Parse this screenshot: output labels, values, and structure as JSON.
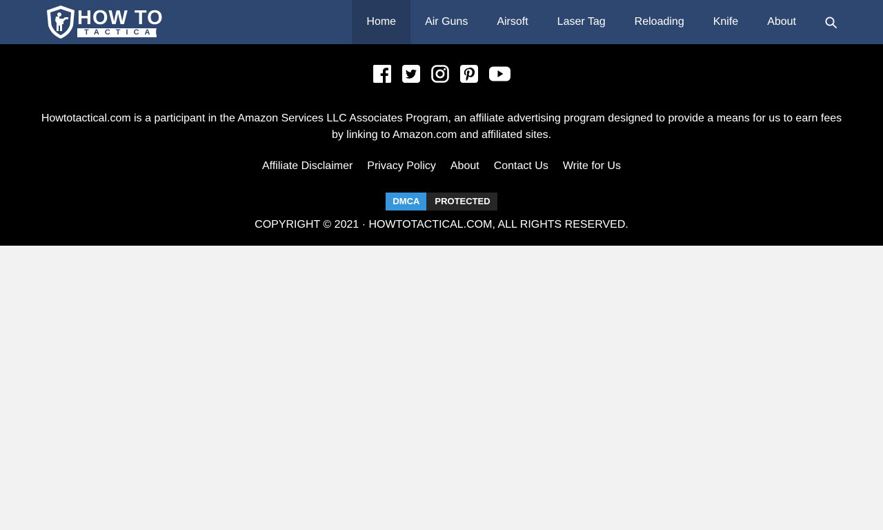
{
  "header": {
    "logo": {
      "line1": "HOW TO",
      "line2": "TACTICAL"
    },
    "nav": [
      {
        "label": "Home",
        "active": true
      },
      {
        "label": "Air Guns"
      },
      {
        "label": "Airsoft"
      },
      {
        "label": "Laser Tag"
      },
      {
        "label": "Reloading"
      },
      {
        "label": "Knife"
      },
      {
        "label": "About"
      }
    ],
    "search_icon": "search-icon"
  },
  "footer": {
    "social": [
      "facebook-icon",
      "twitter-icon",
      "instagram-icon",
      "pinterest-icon",
      "youtube-icon"
    ],
    "disclosure": "Howtotactical.com is a participant in the Amazon Services LLC Associates Program, an affiliate advertising program designed to provide a means for us to earn fees by linking to Amazon.com and affiliated sites.",
    "links": [
      "Affiliate Disclaimer",
      "Privacy Policy",
      "About",
      "Contact Us",
      "Write for Us"
    ],
    "dmca": {
      "left": "DMCA",
      "right": "PROTECTED"
    },
    "copyright": "COPYRIGHT © 2021 · HOWTOTACTICAL.COM, ALL RIGHTS RESERVED."
  },
  "colors": {
    "header_bg": "#2e4771",
    "nav_active_bg": "#263b5e",
    "footer_bg": "#000000",
    "page_bg": "#f2f2f2",
    "dmca_blue": "#3596dd"
  }
}
